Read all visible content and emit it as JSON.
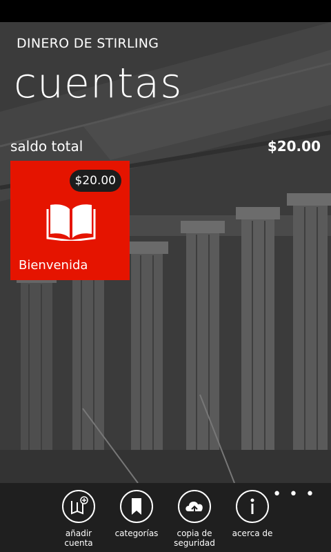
{
  "app": {
    "name": "DINERO DE STIRLING"
  },
  "page": {
    "title": "cuentas"
  },
  "summary": {
    "total_label": "saldo total",
    "total_value": "$20.00"
  },
  "accounts": [
    {
      "name": "Bienvenida",
      "balance": "$20.00",
      "icon": "book-icon",
      "color": "#e51400"
    }
  ],
  "appbar": {
    "more_label": "• • •",
    "buttons": [
      {
        "label": "añadir\ncuenta",
        "icon": "add-account-icon"
      },
      {
        "label": "categorías",
        "icon": "bookmark-icon"
      },
      {
        "label": "copia de\nseguridad",
        "icon": "cloud-upload-icon"
      },
      {
        "label": "acerca de",
        "icon": "info-icon"
      }
    ]
  }
}
